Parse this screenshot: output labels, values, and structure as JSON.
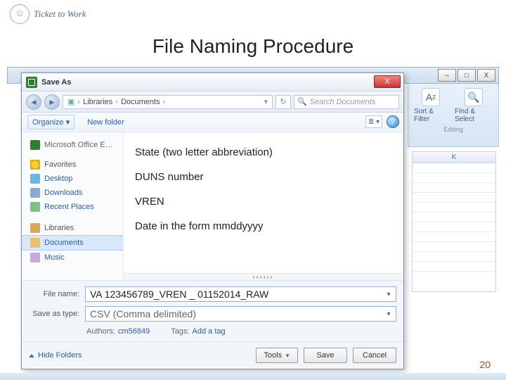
{
  "logo_text": "Ticket to Work",
  "slide_title": "File Naming Procedure",
  "page_number": "20",
  "excel": {
    "window_buttons": {
      "min": "–",
      "max": "□",
      "close": "X"
    },
    "ribbon": {
      "sort_filter": "Sort & Filter",
      "find_select": "Find & Select",
      "group": "Editing"
    },
    "column_header": "K",
    "formula_label": "Microsoft Office E…"
  },
  "dialog": {
    "title": "Save As",
    "close": "X",
    "nav_back": "◄",
    "nav_fwd": "►",
    "breadcrumb": {
      "root": "Libraries",
      "sep": "›",
      "folder": "Documents"
    },
    "refresh": "↻",
    "search_placeholder": "Search Documents",
    "toolbar": {
      "organize": "Organize ▾",
      "new_folder": "New folder",
      "view": "≣ ▾",
      "help": "?"
    },
    "sidebar": {
      "favorites": "Favorites",
      "desktop": "Desktop",
      "downloads": "Downloads",
      "recent": "Recent Places",
      "libraries": "Libraries",
      "documents": "Documents",
      "music": "Music"
    },
    "instructions": {
      "line1": "State (two letter abbreviation)",
      "line2": "DUNS number",
      "line3": "VREN",
      "line4": "Date in the form mmddyyyy"
    },
    "grip": "resize",
    "filename_label": "File name:",
    "filename_value": "VA 123456789_VREN _ 01152014_RAW",
    "filetype_label": "Save as type:",
    "filetype_value": "CSV (Comma delimited)",
    "authors_label": "Authors:",
    "authors_value": "cm56849",
    "tags_label": "Tags:",
    "tags_value": "Add a tag",
    "hide_folders": "Hide Folders",
    "tools": "Tools",
    "save": "Save",
    "cancel": "Cancel"
  }
}
